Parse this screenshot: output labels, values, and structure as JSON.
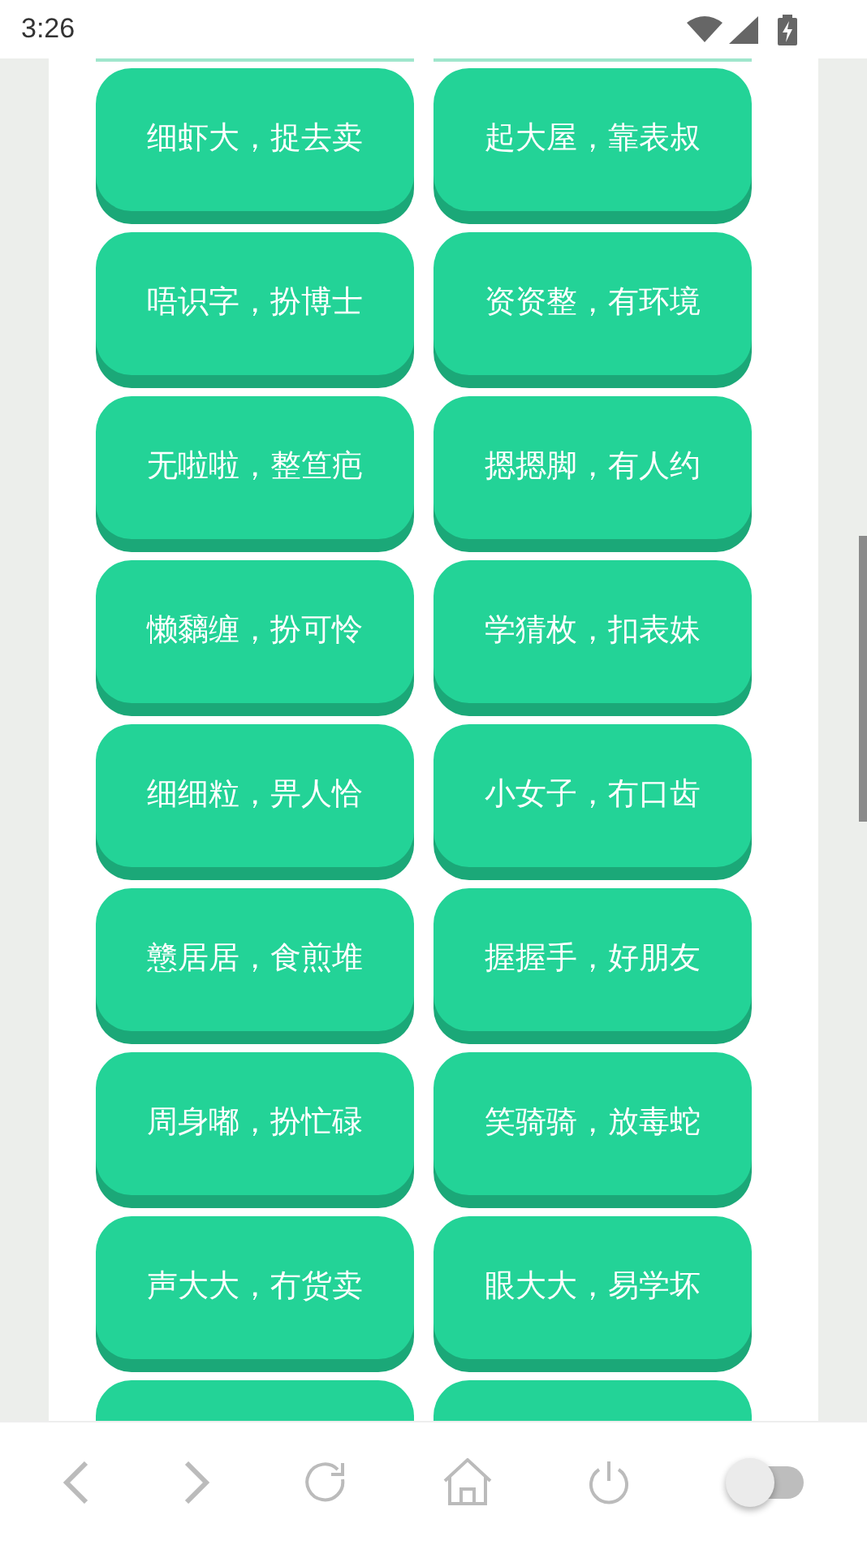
{
  "status_bar": {
    "time": "3:26"
  },
  "buttons": [
    {
      "kind": "button",
      "label": "细虾大，捉去卖"
    },
    {
      "kind": "button",
      "label": "起大屋，靠表叔"
    },
    {
      "kind": "button",
      "label": "唔识字，扮博士"
    },
    {
      "kind": "button",
      "label": "资资整，有环境"
    },
    {
      "kind": "button",
      "label": "无啦啦，整笪疤"
    },
    {
      "kind": "button",
      "label": "摁摁脚，有人约"
    },
    {
      "kind": "button",
      "label": "懒黐缠，扮可怜"
    },
    {
      "kind": "button",
      "label": "学猜枚，扣表妹"
    },
    {
      "kind": "button",
      "label": "细细粒，畀人恰"
    },
    {
      "kind": "button",
      "label": "小女子，冇口齿"
    },
    {
      "kind": "button",
      "label": "戆居居，食煎堆"
    },
    {
      "kind": "button",
      "label": "握握手，好朋友"
    },
    {
      "kind": "button",
      "label": "周身嘟，扮忙碌"
    },
    {
      "kind": "button",
      "label": "笑骑骑，放毒蛇"
    },
    {
      "kind": "button",
      "label": "声大大，冇货卖"
    },
    {
      "kind": "button",
      "label": "眼大大，易学坏"
    },
    {
      "kind": "cut_off"
    },
    {
      "kind": "cut_off"
    }
  ],
  "toggle": {
    "on": false
  }
}
